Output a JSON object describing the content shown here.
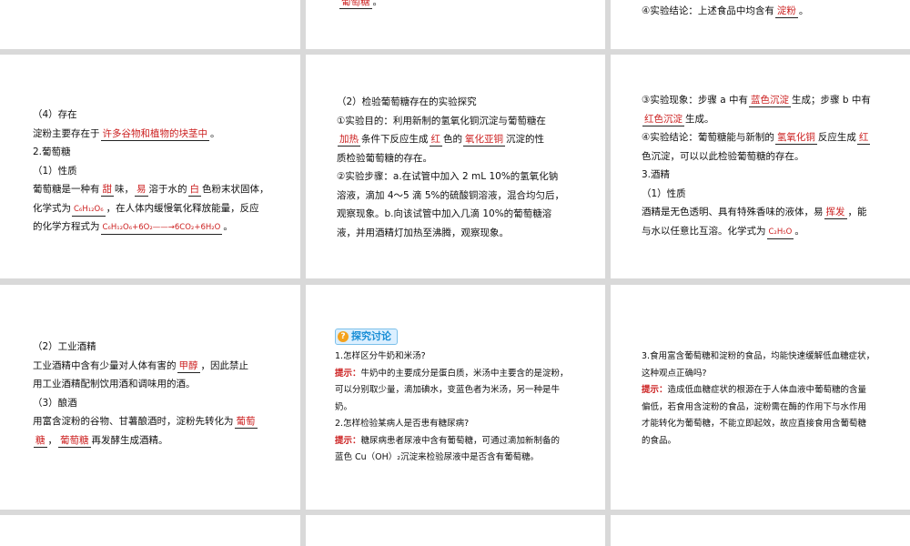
{
  "top_middle": {
    "answer": "葡萄糖",
    "end": "。"
  },
  "top_right": {
    "text": "④实验结论：上述食品中均含有",
    "answer": "淀粉",
    "end": "。"
  },
  "panel1": {
    "l1": "（4）存在",
    "l2_pre": "淀粉主要存在于",
    "l2_ans": "许多谷物和植物的块茎中",
    "l2_end": "。",
    "l3": "2.葡萄糖",
    "l4": "（1）性质",
    "l5_a": "葡萄糖是一种有",
    "l5_ans1": "甜",
    "l5_b": "味，",
    "l5_ans2": "易",
    "l5_c": "溶于水的",
    "l5_ans3": "白",
    "l5_d": "色粉末状固体，",
    "l6_a": "化学式为",
    "l6_ans": "C₆H₁₂O₆",
    "l6_b": "，在人体内缓慢氧化释放能量，反应",
    "l7_a": "的化学方程式为",
    "l7_ans": "C₆H₁₂O₆+6O₂——→6CO₂+6H₂O",
    "l7_end": "。"
  },
  "panel2": {
    "l1": "（2）检验葡萄糖存在的实验探究",
    "l2": "①实验目的：利用新制的氢氧化铜沉淀与葡萄糖在",
    "l3_ans1": "加热",
    "l3_a": "条件下反应生成",
    "l3_ans2": "红",
    "l3_b": "色的",
    "l3_ans3": "氧化亚铜",
    "l3_c": "沉淀的性",
    "l4": "质检验葡萄糖的存在。",
    "l5": "②实验步骤：a.在试管中加入 2 mL 10%的氢氧化钠",
    "l6": "溶液，滴加 4～5 滴 5%的硫酸铜溶液，混合均匀后，",
    "l7": "观察现象。b.向该试管中加入几滴 10%的葡萄糖溶",
    "l8": "液，并用酒精灯加热至沸腾，观察现象。"
  },
  "panel3": {
    "l1_a": "③实验现象：步骤 a 中有",
    "l1_ans": "蓝色沉淀",
    "l1_b": "生成；步骤 b 中有",
    "l2_ans": "红色沉淀",
    "l2_b": "生成。",
    "l3_a": "④实验结论：葡萄糖能与新制的",
    "l3_ans": "氢氧化铜",
    "l3_b": "反应生成",
    "l3_ans2": "红",
    "l4": "色沉淀，可以以此检验葡萄糖的存在。",
    "l5": "3.酒精",
    "l6": "（1）性质",
    "l7_a": "酒精是无色透明、具有特殊香味的液体，易",
    "l7_ans": "挥发",
    "l7_b": "，能",
    "l8_a": "与水以任意比互溶。化学式为",
    "l8_ans": "C₂H₅O",
    "l8_end": "。"
  },
  "panel4": {
    "l1": "（2）工业酒精",
    "l2_a": "工业酒精中含有少量对人体有害的",
    "l2_ans": "甲醇",
    "l2_b": "，因此禁止",
    "l3": "用工业酒精配制饮用酒和调味用的酒。",
    "l4": "（3）酿酒",
    "l5_a": "用富含淀粉的谷物、甘薯酿酒时，淀粉先转化为",
    "l5_ans": "葡萄",
    "l6_ans1": "糖",
    "l6_a": "，",
    "l6_ans2": "葡萄糖",
    "l6_b": "再发酵生成酒精。"
  },
  "panel5": {
    "badge": "探究讨论",
    "q1": "1.怎样区分牛奶和米汤?",
    "hint_label": "提示：",
    "a1_1": "牛奶中的主要成分是蛋白质，米汤中主要含的是淀粉，",
    "a1_2": "可以分别取少量，滴加碘水，变蓝色者为米汤，另一种是牛",
    "a1_3": "奶。",
    "q2": "2.怎样检验某病人是否患有糖尿病?",
    "a2_1": "糖尿病患者尿液中含有葡萄糖，可通过滴加新制备的",
    "a2_2": "蓝色 Cu（OH）₂沉淀来检验尿液中是否含有葡萄糖。"
  },
  "panel6": {
    "q3_1": "3.食用富含葡萄糖和淀粉的食品，均能快速缓解低血糖症状，",
    "q3_2": "这种观点正确吗?",
    "hint_label": "提示：",
    "a3_1": "造成低血糖症状的根源在于人体血液中葡萄糖的含量",
    "a3_2": "偏低，若食用含淀粉的食品，淀粉需在酶的作用下与水作用",
    "a3_3": "才能转化为葡萄糖，不能立即起效，故应直接食用含葡萄糖",
    "a3_4": "的食品。"
  },
  "colors": {
    "answer": "#cc1f1f",
    "badge_bg": "#dbefff",
    "badge_text": "#1b8fd6"
  }
}
